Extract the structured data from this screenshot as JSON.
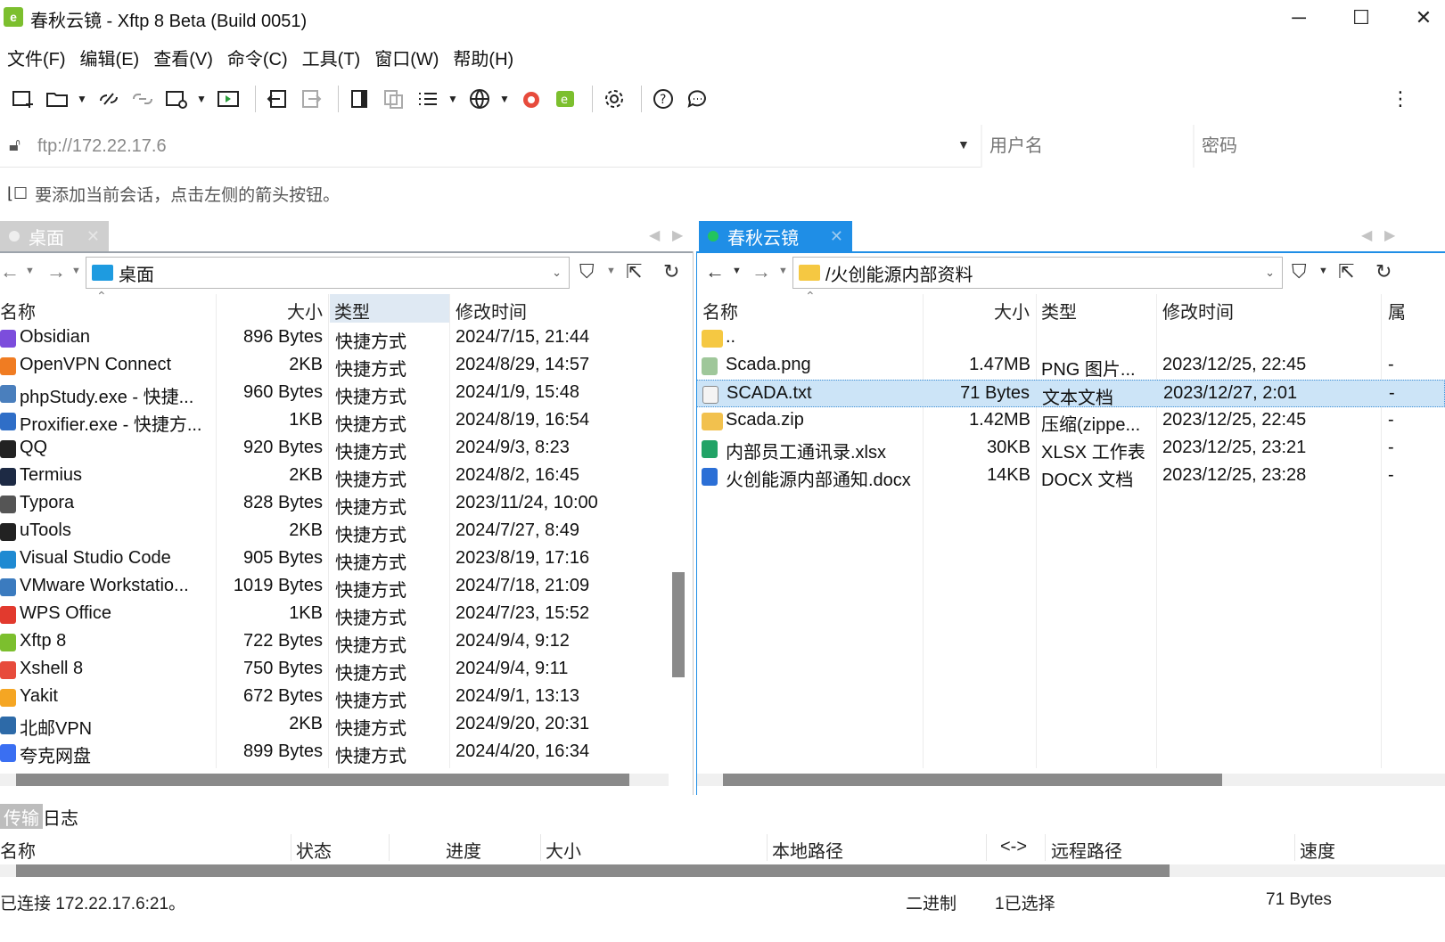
{
  "window": {
    "title": "春秋云镜 - Xftp 8 Beta (Build 0051)",
    "minimize": "─",
    "maximize": "☐",
    "close": "✕"
  },
  "menu": [
    "文件(F)",
    "编辑(E)",
    "查看(V)",
    "命令(C)",
    "工具(T)",
    "窗口(W)",
    "帮助(H)"
  ],
  "address": {
    "url": "ftp://172.22.17.6",
    "username_placeholder": "用户名",
    "password_placeholder": "密码"
  },
  "hint": "要添加当前会话，点击左侧的箭头按钮。",
  "left": {
    "tab": "桌面",
    "path": "桌面",
    "columns": [
      "名称",
      "大小",
      "类型",
      "修改时间"
    ],
    "rows": [
      {
        "name": "Obsidian",
        "size": "896 Bytes",
        "type": "快捷方式",
        "mtime": "2024/7/15, 21:44",
        "color": "#7c4ddc"
      },
      {
        "name": "OpenVPN Connect",
        "size": "2KB",
        "type": "快捷方式",
        "mtime": "2024/8/29, 14:57",
        "color": "#f07c22"
      },
      {
        "name": "phpStudy.exe - 快捷...",
        "size": "960 Bytes",
        "type": "快捷方式",
        "mtime": "2024/1/9, 15:48",
        "color": "#4a7fbd"
      },
      {
        "name": "Proxifier.exe - 快捷方...",
        "size": "1KB",
        "type": "快捷方式",
        "mtime": "2024/8/19, 16:54",
        "color": "#2f6ec7"
      },
      {
        "name": "QQ",
        "size": "920 Bytes",
        "type": "快捷方式",
        "mtime": "2024/9/3, 8:23",
        "color": "#222222"
      },
      {
        "name": "Termius",
        "size": "2KB",
        "type": "快捷方式",
        "mtime": "2024/8/2, 16:45",
        "color": "#1d2a44"
      },
      {
        "name": "Typora",
        "size": "828 Bytes",
        "type": "快捷方式",
        "mtime": "2023/11/24, 10:00",
        "color": "#555555"
      },
      {
        "name": "uTools",
        "size": "2KB",
        "type": "快捷方式",
        "mtime": "2024/7/27, 8:49",
        "color": "#222222"
      },
      {
        "name": "Visual Studio Code",
        "size": "905 Bytes",
        "type": "快捷方式",
        "mtime": "2023/8/19, 17:16",
        "color": "#1f8ad2"
      },
      {
        "name": "VMware Workstatio...",
        "size": "1019 Bytes",
        "type": "快捷方式",
        "mtime": "2024/7/18, 21:09",
        "color": "#3b7bbf"
      },
      {
        "name": "WPS Office",
        "size": "1KB",
        "type": "快捷方式",
        "mtime": "2024/7/23, 15:52",
        "color": "#e23a2e"
      },
      {
        "name": "Xftp 8",
        "size": "722 Bytes",
        "type": "快捷方式",
        "mtime": "2024/9/4, 9:12",
        "color": "#7cbf2e"
      },
      {
        "name": "Xshell 8",
        "size": "750 Bytes",
        "type": "快捷方式",
        "mtime": "2024/9/4, 9:11",
        "color": "#e74b3c"
      },
      {
        "name": "Yakit",
        "size": "672 Bytes",
        "type": "快捷方式",
        "mtime": "2024/9/1, 13:13",
        "color": "#f5a623"
      },
      {
        "name": "北邮VPN",
        "size": "2KB",
        "type": "快捷方式",
        "mtime": "2024/9/20, 20:31",
        "color": "#2d6aa8"
      },
      {
        "name": "夸克网盘",
        "size": "899 Bytes",
        "type": "快捷方式",
        "mtime": "2024/4/20, 16:34",
        "color": "#3a6ff2"
      }
    ]
  },
  "right": {
    "tab": "春秋云镜",
    "path": "/火创能源内部资料",
    "columns": [
      "名称",
      "大小",
      "类型",
      "修改时间",
      "属"
    ],
    "rows": [
      {
        "name": "..",
        "size": "",
        "type": "",
        "mtime": "",
        "extra": "",
        "color": "#f5c842"
      },
      {
        "name": "Scada.png",
        "size": "1.47MB",
        "type": "PNG 图片...",
        "mtime": "2023/12/25, 22:45",
        "extra": "-",
        "color": "#9fc79a"
      },
      {
        "name": "SCADA.txt",
        "size": "71 Bytes",
        "type": "文本文档",
        "mtime": "2023/12/27, 2:01",
        "extra": "-",
        "color": "#dcdcdc",
        "selected": true
      },
      {
        "name": "Scada.zip",
        "size": "1.42MB",
        "type": "压缩(zippe...",
        "mtime": "2023/12/25, 22:45",
        "extra": "-",
        "color": "#f2c14e"
      },
      {
        "name": "内部员工通讯录.xlsx",
        "size": "30KB",
        "type": "XLSX 工作表",
        "mtime": "2023/12/25, 23:21",
        "extra": "-",
        "color": "#21a366"
      },
      {
        "name": "火创能源内部通知.docx",
        "size": "14KB",
        "type": "DOCX 文档",
        "mtime": "2023/12/25, 23:28",
        "extra": "-",
        "color": "#2b6fd6"
      }
    ]
  },
  "bottom": {
    "tabs": [
      "传输",
      "日志"
    ],
    "columns": [
      "名称",
      "状态",
      "进度",
      "大小",
      "本地路径",
      "<->",
      "远程路径",
      "速度"
    ]
  },
  "status": {
    "connection": "已连接 172.22.17.6:21。",
    "mode": "二进制",
    "selection": "1已选择",
    "size": "71 Bytes"
  },
  "colors": {
    "accent": "#1f8ee6",
    "selection": "#cce4f7",
    "session_online": "#22c55e"
  }
}
